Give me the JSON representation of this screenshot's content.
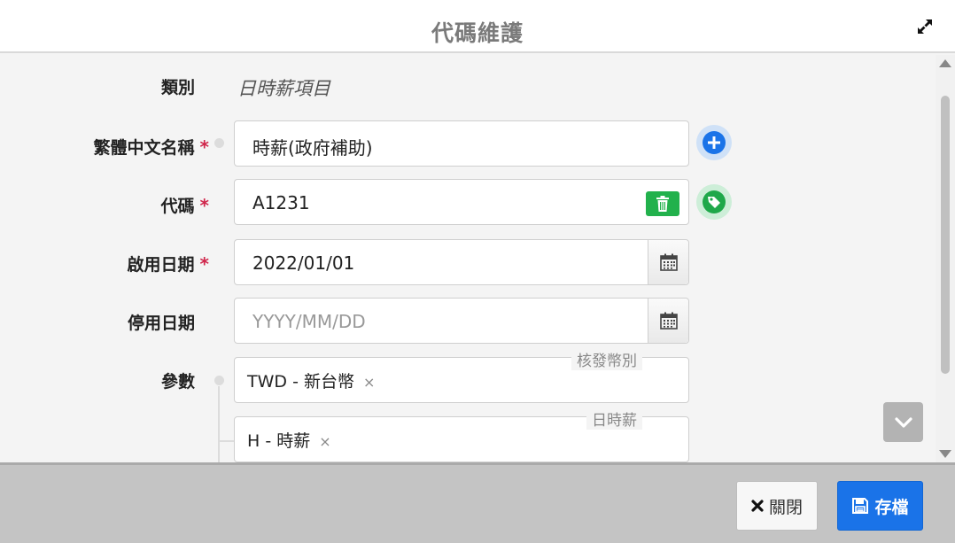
{
  "dialog": {
    "title": "代碼維護"
  },
  "form": {
    "category": {
      "label": "類別",
      "value": "日時薪項目"
    },
    "name_zh": {
      "label": "繁體中文名稱",
      "required_mark": "*",
      "value": "時薪(政府補助)"
    },
    "code": {
      "label": "代碼",
      "required_mark": "*",
      "value": "A1231"
    },
    "start_date": {
      "label": "啟用日期",
      "required_mark": "*",
      "value": "2022/01/01"
    },
    "end_date": {
      "label": "停用日期",
      "placeholder": "YYYY/MM/DD",
      "value": ""
    },
    "params": {
      "label": "參數",
      "fields": [
        {
          "legend": "核發幣別",
          "chip": "TWD - 新台幣",
          "remove": "×"
        },
        {
          "legend": "日時薪",
          "chip": "H - 時薪",
          "remove": "×"
        }
      ]
    }
  },
  "footer": {
    "close_label": "關閉",
    "save_label": "存檔"
  },
  "colors": {
    "accent": "#1a73e8",
    "required": "#d0264b",
    "success": "#22b14c",
    "add_button": "#1a73e8"
  },
  "icons": {
    "expand": "expand-icon",
    "add": "plus-circle-icon",
    "tag": "tag-icon",
    "delete": "trash-icon",
    "calendar": "calendar-icon",
    "scroll_down": "chevron-down-icon",
    "close": "close-icon",
    "save": "floppy-disk-icon"
  }
}
